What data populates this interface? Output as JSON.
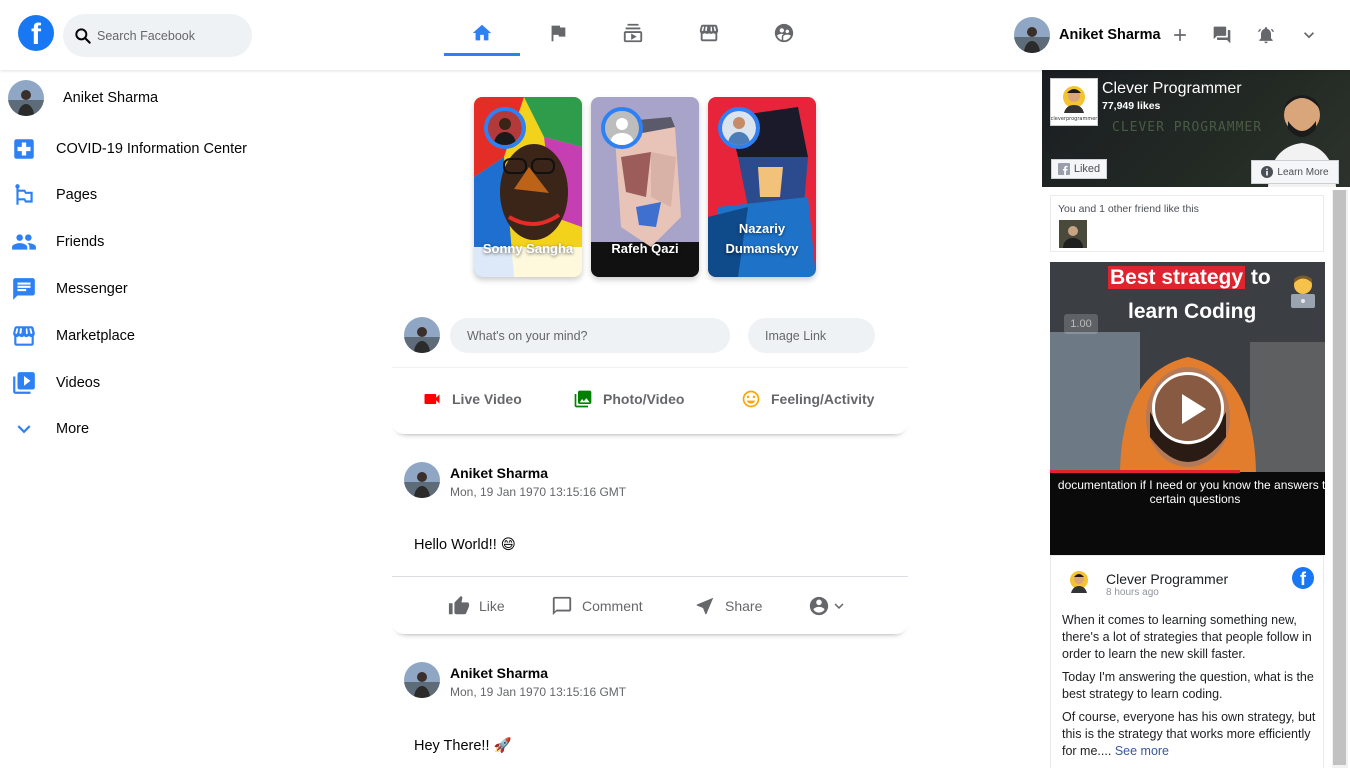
{
  "header": {
    "logo_letter": "f",
    "search_placeholder": "Search Facebook",
    "user_name": "Aniket Sharma",
    "nav_icons": [
      "home-icon",
      "flag-icon",
      "subscriptions-icon",
      "storefront-icon",
      "supervised-user-icon"
    ],
    "right_icons": [
      "add-icon",
      "forum-icon",
      "notifications-icon",
      "expand-more-icon"
    ],
    "accent_color": "#2e81f4"
  },
  "sidebar": {
    "profile_name": "Aniket Sharma",
    "items": [
      {
        "label": "COVID-19 Information Center",
        "icon": "local-hospital-icon"
      },
      {
        "label": "Pages",
        "icon": "emoji-flags-icon"
      },
      {
        "label": "Friends",
        "icon": "people-icon"
      },
      {
        "label": "Messenger",
        "icon": "chat-icon"
      },
      {
        "label": "Marketplace",
        "icon": "storefront-icon"
      },
      {
        "label": "Videos",
        "icon": "video-library-icon"
      },
      {
        "label": "More",
        "icon": "expand-more-icon"
      }
    ]
  },
  "stories": [
    {
      "name": "Sonny Sangha"
    },
    {
      "name": "Rafeh Qazi"
    },
    {
      "name": "Nazariy Dumanskyy"
    }
  ],
  "composer": {
    "placeholder": "What's on your mind?",
    "image_placeholder": "Image Link",
    "options": [
      {
        "label": "Live Video",
        "icon": "videocam-icon",
        "color": "#ff0000"
      },
      {
        "label": "Photo/Video",
        "icon": "photo-library-icon",
        "color": "#008000"
      },
      {
        "label": "Feeling/Activity",
        "icon": "insert-emoticon-icon",
        "color": "#ffa500"
      }
    ]
  },
  "posts": [
    {
      "username": "Aniket Sharma",
      "timestamp": "Mon, 19 Jan 1970 13:15:16 GMT",
      "message": "Hello World!! 😄"
    },
    {
      "username": "Aniket Sharma",
      "timestamp": "Mon, 19 Jan 1970 13:15:16 GMT",
      "message": "Hey There!! 🚀"
    }
  ],
  "post_actions": {
    "like": "Like",
    "comment": "Comment",
    "share": "Share"
  },
  "widget": {
    "page_name": "Clever Programmer",
    "likes": "77,949 likes",
    "cover_text": "CLEVER PROGRAMMER",
    "logo_caption": "cleverprogrammer",
    "liked_label": "Liked",
    "learn_more_label": "Learn More",
    "friends_text": "You and 1 other friend like this",
    "video": {
      "title_highlight": "Best strategy",
      "title_rest": " to",
      "title_line2": "learn Coding",
      "speed": "1.00",
      "caption": "documentation if I need or you know the answers to certain questions"
    },
    "post": {
      "author": "Clever Programmer",
      "time": "8 hours ago",
      "paragraphs": [
        "When it comes to learning something new, there's a lot of strategies that people follow in order to learn the new skill faster.",
        "Today I'm answering the question, what is the best strategy to learn coding."
      ],
      "last_paragraph": "Of course, everyone has his own strategy, but this is the strategy that works more efficiently for me.",
      "ellipsis": "... ",
      "see_more": "See more"
    }
  }
}
